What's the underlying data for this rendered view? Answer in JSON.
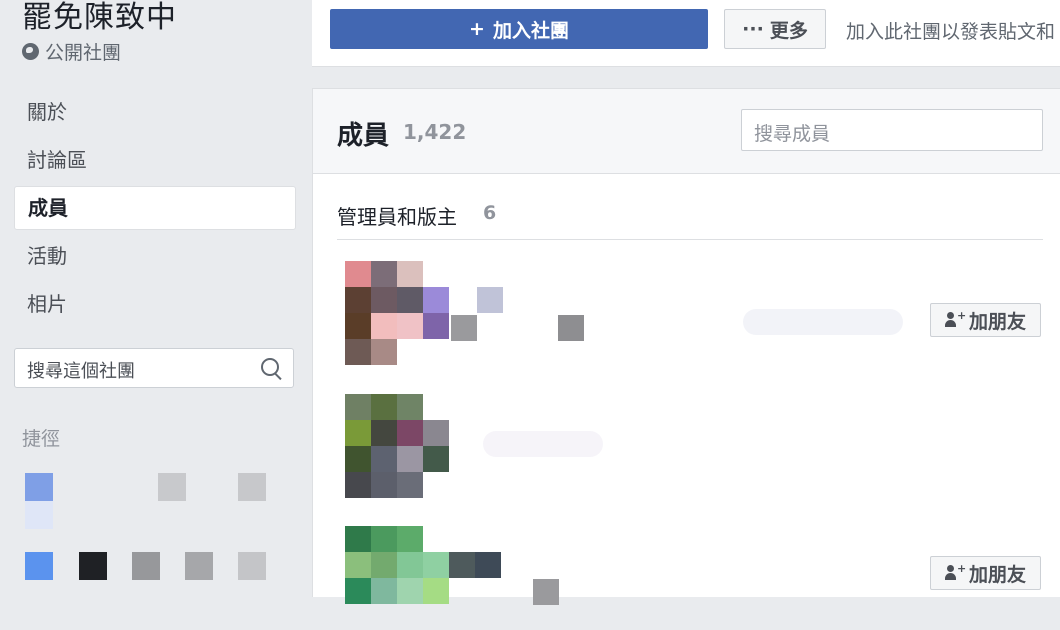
{
  "group": {
    "title": "罷免陳致中",
    "type": "公開社團"
  },
  "sidebar": {
    "items": [
      {
        "label": "關於",
        "active": false
      },
      {
        "label": "討論區",
        "active": false
      },
      {
        "label": "成員",
        "active": true
      },
      {
        "label": "活動",
        "active": false
      },
      {
        "label": "相片",
        "active": false
      }
    ],
    "search_placeholder": "搜尋這個社團",
    "shortcuts_label": "捷徑"
  },
  "topbar": {
    "join_label": "加入社團",
    "join_icon": "+",
    "more_icon": "···",
    "more_label": "更多",
    "hint": "加入此社團以發表貼文和"
  },
  "members": {
    "title": "成員",
    "count": "1,422",
    "search_placeholder": "搜尋成員",
    "section_title": "管理員和版主",
    "section_count": "6",
    "add_friend_label": "加朋友"
  },
  "colors": {
    "brand": "#4267b2",
    "page_bg": "#e9ebee"
  }
}
